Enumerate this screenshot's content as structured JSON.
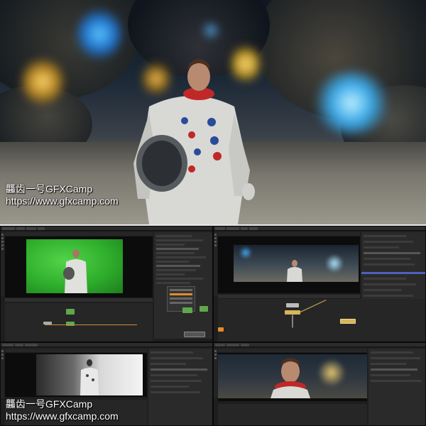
{
  "watermark": {
    "line1": "龘齿一号GFXCamp",
    "line2": "https://www.gfxcamp.com"
  },
  "colors": {
    "green_screen": "#2fae2c",
    "node_green": "#5fa84a",
    "node_orange": "#e58a2a",
    "node_yellow": "#d8b45a",
    "ui_bg": "#1e1e1e",
    "glow_blue": "#3aa8e8",
    "glow_gold": "#e8c050",
    "suit_red": "#c02828"
  },
  "icons": [
    "toolbar-icon"
  ]
}
